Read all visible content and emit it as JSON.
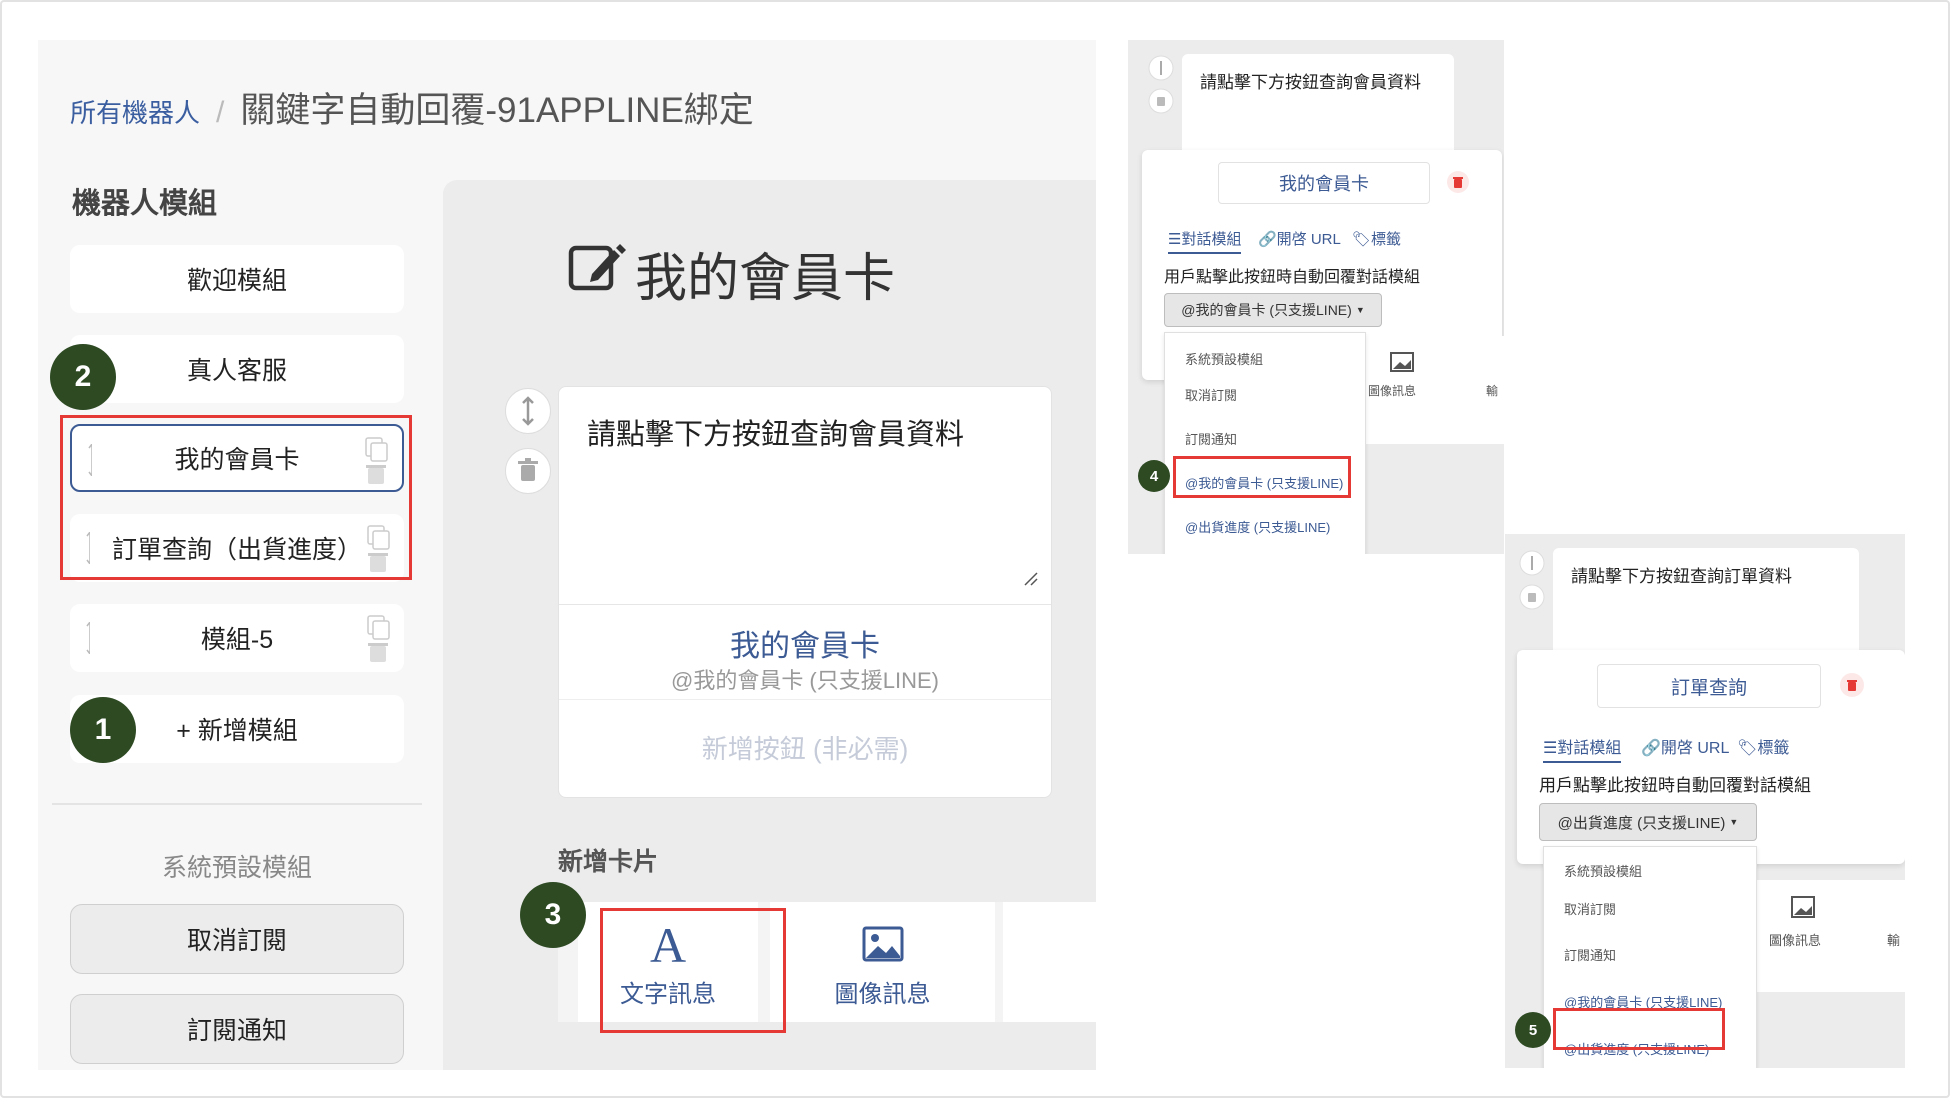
{
  "breadcrumb": {
    "root": "所有機器人",
    "separator": "/",
    "current": "關鍵字自動回覆-91APPLINE綁定"
  },
  "sidebar": {
    "title": "機器人模組",
    "modules": [
      "歡迎模組",
      "真人客服",
      "我的會員卡",
      "訂單查詢（出貨進度）",
      "模組-5"
    ],
    "add_label": "+ 新增模組",
    "system_title": "系統預設模組",
    "system_modules": [
      "取消訂閱",
      "訂閱通知"
    ]
  },
  "editor": {
    "title": "我的會員卡",
    "message_text": "請點擊下方按鈕查詢會員資料",
    "button_label": "我的會員卡",
    "button_sub": "@我的會員卡 (只支援LINE)",
    "add_button_hint": "新增按鈕 (非必需)",
    "add_card_title": "新增卡片",
    "card_types": [
      {
        "glyph": "A",
        "label": "文字訊息"
      },
      {
        "label": "圖像訊息"
      }
    ]
  },
  "steps": [
    "1",
    "2",
    "3",
    "4",
    "5"
  ],
  "snip_a": {
    "message_text": "請點擊下方按鈕查詢會員資料",
    "button_name": "我的會員卡",
    "tabs": [
      "☰對話模組",
      "🔗開啓 URL",
      "🏷標籤"
    ],
    "instruction": "用戶點擊此按鈕時自動回覆對話模組",
    "selected": "@我的會員卡 (只支援LINE)",
    "options": [
      "系統預設模組",
      "取消訂閱",
      "訂閱通知",
      "@我的會員卡 (只支援LINE)",
      "@出貨進度 (只支援LINE)"
    ],
    "behind_label": "圖像訊息",
    "behind_label2": "輸"
  },
  "snip_b": {
    "message_text": "請點擊下方按鈕查詢訂單資料",
    "button_name": "訂單查詢",
    "tabs": [
      "☰對話模組",
      "🔗開啓 URL",
      "🏷標籤"
    ],
    "instruction": "用戶點擊此按鈕時自動回覆對話模組",
    "selected": "@出貨進度 (只支援LINE)",
    "options": [
      "系統預設模組",
      "取消訂閱",
      "訂閱通知",
      "@我的會員卡 (只支援LINE)",
      "@出貨進度 (只支援LINE)"
    ],
    "behind_label": "圖像訊息",
    "behind_label2": "輸"
  },
  "colors": {
    "accent": "#3c5a93",
    "badge": "#2d4a23",
    "highlight": "#e53935",
    "delete": "#e53935"
  }
}
